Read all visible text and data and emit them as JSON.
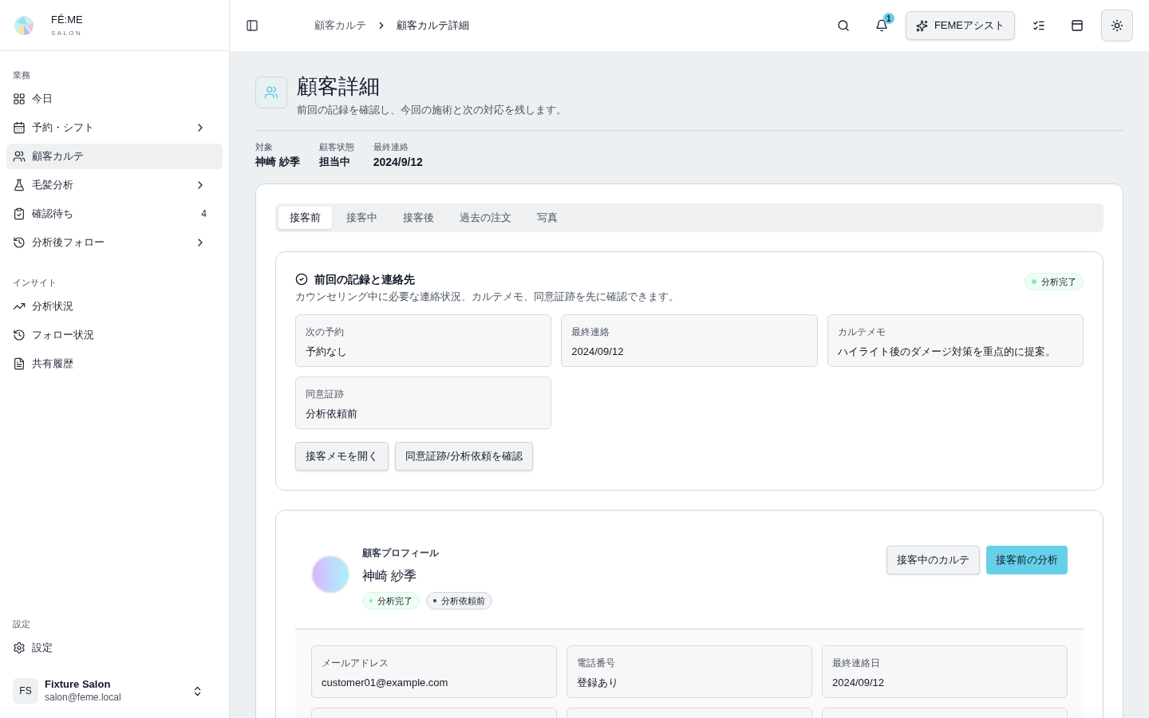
{
  "brand": {
    "name": "FÉ:ME",
    "sub": "SALON"
  },
  "sidebar": {
    "sections": [
      {
        "label": "業務",
        "items": [
          {
            "label": "今日",
            "selected": false,
            "chevron": false
          },
          {
            "label": "予約・シフト",
            "selected": false,
            "chevron": true
          },
          {
            "label": "顧客カルテ",
            "selected": true,
            "chevron": false
          },
          {
            "label": "毛髪分析",
            "selected": false,
            "chevron": true
          },
          {
            "label": "確認待ち",
            "selected": false,
            "chevron": false,
            "count": "4"
          },
          {
            "label": "分析後フォロー",
            "selected": false,
            "chevron": true
          }
        ]
      },
      {
        "label": "インサイト",
        "items": [
          {
            "label": "分析状況",
            "selected": false,
            "chevron": false
          },
          {
            "label": "フォロー状況",
            "selected": false,
            "chevron": false
          },
          {
            "label": "共有履歴",
            "selected": false,
            "chevron": false
          }
        ]
      }
    ],
    "settings": {
      "label": "設定",
      "items": [
        {
          "label": "設定",
          "selected": false,
          "chevron": false
        }
      ]
    },
    "user": {
      "initials": "FS",
      "name": "Fixture Salon",
      "email": "salon@feme.local"
    }
  },
  "topbar": {
    "breadcrumb": [
      "顧客カルテ",
      "顧客カルテ詳細"
    ],
    "notification_count": "1",
    "assist": "FEMEアシスト"
  },
  "page": {
    "title": "顧客詳細",
    "subtitle": "前回の記録を確認し、今回の施術と次の対応を残します。",
    "meta": [
      {
        "label": "対象",
        "value": "神崎 紗季"
      },
      {
        "label": "顧客状態",
        "value": "担当中"
      },
      {
        "label": "最終連絡",
        "value": "2024/9/12"
      }
    ]
  },
  "tabs": [
    {
      "label": "接客前",
      "selected": true
    },
    {
      "label": "接客中",
      "selected": false
    },
    {
      "label": "接客後",
      "selected": false
    },
    {
      "label": "過去の注文",
      "selected": false
    },
    {
      "label": "写真",
      "selected": false
    }
  ],
  "record_card": {
    "title": "前回の記録と連絡先",
    "description": "カウンセリング中に必要な連絡状況、カルテメモ、同意証跡を先に確認できます。",
    "badge": {
      "label": "分析完了",
      "color": "#86efac"
    },
    "fields": [
      {
        "label": "次の予約",
        "value": "予約なし"
      },
      {
        "label": "最終連絡",
        "value": "2024/09/12"
      },
      {
        "label": "カルテメモ",
        "value": "ハイライト後のダメージ対策を重点的に提案。"
      },
      {
        "label": "同意証跡",
        "value": "分析依頼前"
      }
    ],
    "buttons": [
      "接客メモを開く",
      "同意証跡/分析依頼を確認"
    ]
  },
  "profile": {
    "heading": "顧客プロフィール",
    "name": "神崎 紗季",
    "badges": [
      {
        "label": "分析完了",
        "color": "#86efac",
        "kind": "success"
      },
      {
        "label": "分析依頼前",
        "color": "#374151",
        "kind": "neutral"
      }
    ],
    "buttons": [
      {
        "label": "接客中のカルテ",
        "kind": "secondary"
      },
      {
        "label": "接客前の分析",
        "kind": "primary"
      }
    ],
    "fields": [
      {
        "label": "メールアドレス",
        "value": "customer01@example.com"
      },
      {
        "label": "電話番号",
        "value": "登録あり"
      },
      {
        "label": "最終連絡日",
        "value": "2024/09/12"
      }
    ]
  }
}
